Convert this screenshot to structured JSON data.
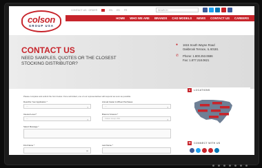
{
  "header": {
    "logo": {
      "main": "colson",
      "sub": "GROUP USA"
    },
    "utility_items": [
      "CONTACT US · ORDER",
      "EN",
      "ES",
      "FR"
    ],
    "search_placeholder": "SEARCH",
    "nav_items": [
      "HOME",
      "WHO WE ARE",
      "BRANDS",
      "CAD MODELS",
      "NEWS",
      "CONTACT US",
      "CAREERS"
    ],
    "social_colors": [
      "#3b5998",
      "#1da1f2",
      "#0077b5",
      "#c7242b",
      "#3b5998"
    ]
  },
  "hero": {
    "title": "CONTACT US",
    "subtitle_line1": "NEED SAMPLES, QUOTES OR THE CLOSEST",
    "subtitle_line2": "STOCKING DISTRIBUTOR?",
    "address_line1": "1615 South Wayne Road",
    "address_line2": "Oakbrook Terrace, IL 60181",
    "phone": "Phone: 1.800.253.0686",
    "fax": "Fax: 1.877.218.0621"
  },
  "form": {
    "intro": "Please complete and submit the form below. Once submitted, one of our representatives will respond as soon as possible.",
    "fields": [
      {
        "label": "Describe Your Application *",
        "value": "---"
      },
      {
        "label": "Annual Caster & Wheel Purchases",
        "value": "---"
      },
      {
        "label": "Interest Level *",
        "value": "---"
      },
      {
        "label": "Brand of Interest *",
        "value": "Colson Group USA"
      },
      {
        "label": "Select Message *",
        "value": ""
      },
      {
        "label": "First Name *",
        "value": ""
      },
      {
        "label": "Last Name *",
        "value": ""
      }
    ]
  },
  "locations": {
    "title": "LOCATIONS",
    "accent": "#c7242b"
  },
  "connect": {
    "title": "CONNECT WITH US",
    "social_colors": [
      "#3b5998",
      "#1da1f2",
      "#c7242b",
      "#c7242b",
      "#0077b5"
    ]
  }
}
